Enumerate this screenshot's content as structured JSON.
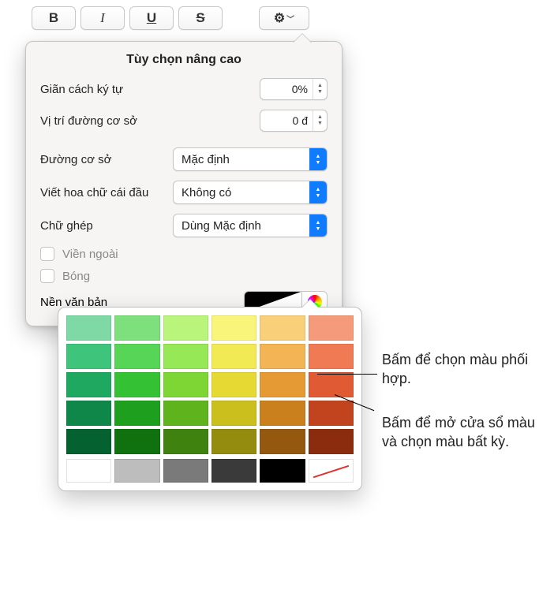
{
  "toolbar": {
    "bold": "B",
    "italic": "I",
    "underline": "U",
    "strike": "S"
  },
  "panel": {
    "title": "Tùy chọn nâng cao",
    "char_spacing_label": "Giãn cách ký tự",
    "char_spacing_value": "0%",
    "baseline_shift_label": "Vị trí đường cơ sở",
    "baseline_shift_value": "0 đ",
    "baseline_label": "Đường cơ sở",
    "baseline_value": "Mặc định",
    "caps_label": "Viết hoa chữ cái đầu",
    "caps_value": "Không có",
    "ligatures_label": "Chữ ghép",
    "ligatures_value": "Dùng Mặc định",
    "outline_label": "Viền ngoài",
    "shadow_label": "Bóng",
    "text_bg_label": "Nền văn bản"
  },
  "callouts": {
    "swatch": "Bấm để chọn màu phối hợp.",
    "wheel": "Bấm để mở cửa sổ màu và chọn màu bất kỳ."
  },
  "chart_data": {
    "type": "table",
    "color_grid": [
      [
        "#7ed9a4",
        "#7de07d",
        "#b9f57a",
        "#f9f57a",
        "#f9cf7a",
        "#f59a7a"
      ],
      [
        "#3fc47c",
        "#56d556",
        "#96e856",
        "#f2ea54",
        "#f2b454",
        "#ef7a54"
      ],
      [
        "#1fa85f",
        "#34c234",
        "#7dd634",
        "#e6d934",
        "#e69a34",
        "#e05a34"
      ],
      [
        "#0f8748",
        "#1ea01e",
        "#5fb41e",
        "#cbbf1e",
        "#cb801e",
        "#c2441e"
      ],
      [
        "#05612f",
        "#0f720f",
        "#3f820f",
        "#948c0f",
        "#94580f",
        "#8c2c0f"
      ]
    ],
    "bottom_row": [
      "#ffffff",
      "#bdbdbd",
      "#7a7a7a",
      "#3a3a3a",
      "#000000",
      "none"
    ]
  }
}
